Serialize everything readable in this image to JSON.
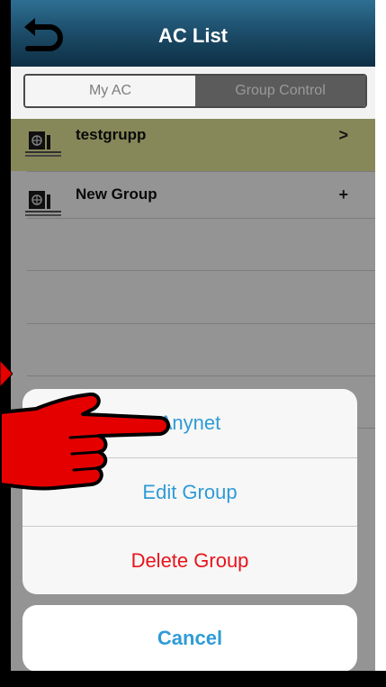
{
  "header": {
    "title": "AC List"
  },
  "segmented": {
    "tabs": [
      "My AC",
      "Group Control"
    ],
    "active": "Group Control"
  },
  "list": {
    "items": [
      {
        "label": "testgrupp",
        "action": ">"
      },
      {
        "label": "New Group",
        "action": "+"
      }
    ]
  },
  "action_sheet": {
    "options": [
      "Anynet",
      "Edit Group",
      "Delete Group"
    ],
    "cancel": "Cancel"
  },
  "colors": {
    "header": "#1d4f6c",
    "selected_row": "#e8ea9a",
    "action_blue": "#2f9bd6",
    "destructive_red": "#e8141b",
    "pointer_red": "#e50000"
  },
  "icons": [
    "back-arrow-icon",
    "ac-unit-icon",
    "pointing-hand-icon"
  ]
}
